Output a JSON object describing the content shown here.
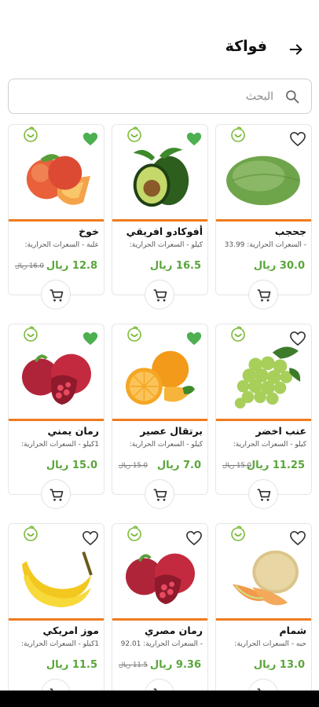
{
  "header": {
    "title": "فواكة",
    "back_icon": "arrow-right-icon"
  },
  "search": {
    "placeholder": "البحث",
    "icon": "search-icon"
  },
  "colors": {
    "accent_green": "#5aa53a",
    "accent_orange": "#f07b1f",
    "heart_green": "#4caf50"
  },
  "products": [
    {
      "name": "خوخ",
      "calories": "علبة - السعرات الحرارية:",
      "price": "12.8 ريال",
      "old_price": "16.0 ريال",
      "favorite": true,
      "fruit": "peach"
    },
    {
      "name": "أفوكادو افريقي",
      "calories": "كيلو - السعرات الحرارية:",
      "price": "16.5 ريال",
      "old_price": "",
      "favorite": true,
      "fruit": "avocado"
    },
    {
      "name": "جحجب",
      "calories": "- السعرات الحرارية: 33.99",
      "price": "30.0 ريال",
      "old_price": "",
      "favorite": false,
      "fruit": "melon-long"
    },
    {
      "name": "رمان يمني",
      "calories": "1كيلو - السعرات الحرارية:",
      "price": "15.0 ريال",
      "old_price": "",
      "favorite": true,
      "fruit": "pomegranate"
    },
    {
      "name": "برتقال عصير",
      "calories": "كيلو - السعرات الحرارية:",
      "price": "7.0 ريال",
      "old_price": "15.0 ريال",
      "favorite": true,
      "fruit": "orange"
    },
    {
      "name": "عنب اخضر",
      "calories": "كيلو - السعرات الحرارية:",
      "price": "11.25 ريال",
      "old_price": "15.0 ريال",
      "favorite": false,
      "fruit": "grapes"
    },
    {
      "name": "موز امريكي",
      "calories": "1كيلو - السعرات الحرارية:",
      "price": "11.5 ريال",
      "old_price": "",
      "favorite": false,
      "fruit": "banana"
    },
    {
      "name": "رمان مصري",
      "calories": "- السعرات الحرارية: 92.01",
      "price": "9.36 ريال",
      "old_price": "11.5 ريال",
      "favorite": false,
      "fruit": "pomegranate"
    },
    {
      "name": "شمام",
      "calories": "حبه - السعرات الحرارية:",
      "price": "13.0 ريال",
      "old_price": "",
      "favorite": false,
      "fruit": "cantaloupe"
    }
  ]
}
